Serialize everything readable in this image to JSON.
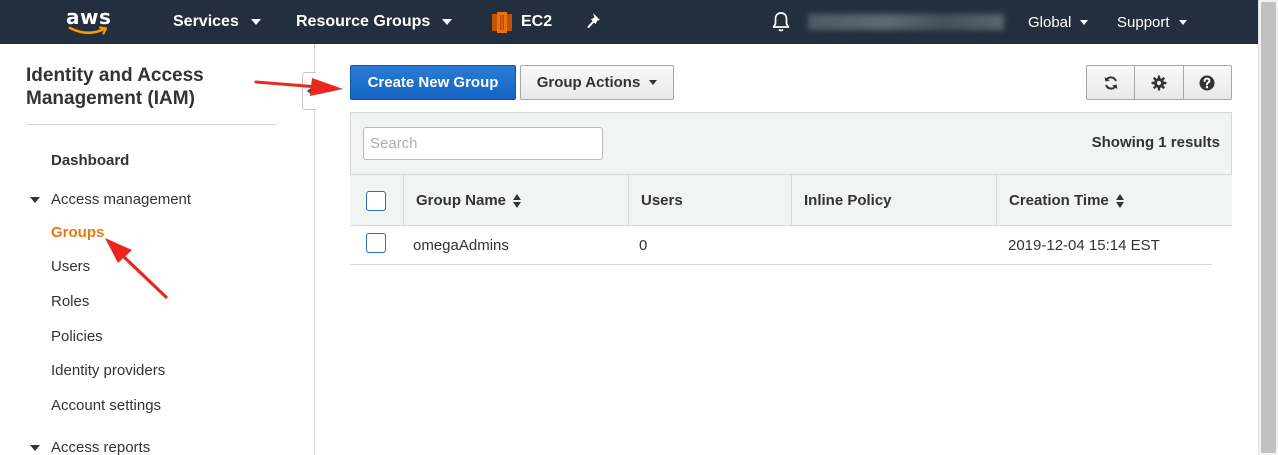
{
  "topnav": {
    "logo_text": "aws",
    "services": "Services",
    "resource_groups": "Resource Groups",
    "ec2": "EC2",
    "region": "Global",
    "support": "Support"
  },
  "sidebar": {
    "title": "Identity and Access Management (IAM)",
    "dashboard": "Dashboard",
    "access_management": "Access management",
    "items": [
      "Groups",
      "Users",
      "Roles",
      "Policies",
      "Identity providers",
      "Account settings"
    ],
    "access_reports": "Access reports"
  },
  "toolbar": {
    "create_group": "Create New Group",
    "group_actions": "Group Actions"
  },
  "table": {
    "search_placeholder": "Search",
    "showing": "Showing 1 results",
    "headers": [
      "Group Name",
      "Users",
      "Inline Policy",
      "Creation Time"
    ],
    "rows": [
      {
        "group_name": "omegaAdmins",
        "users": "0",
        "inline_policy": "",
        "creation_time": "2019-12-04 15:14 EST"
      }
    ]
  },
  "colors": {
    "nav_bg": "#232f3e",
    "primary_button": "#1466c2",
    "active_link": "#e47911",
    "annotation_arrow": "#e8281e"
  },
  "icons": [
    "aws-logo-smile",
    "ec2-icon",
    "pin-icon",
    "bell-icon",
    "refresh-icon",
    "gear-icon",
    "help-icon"
  ]
}
